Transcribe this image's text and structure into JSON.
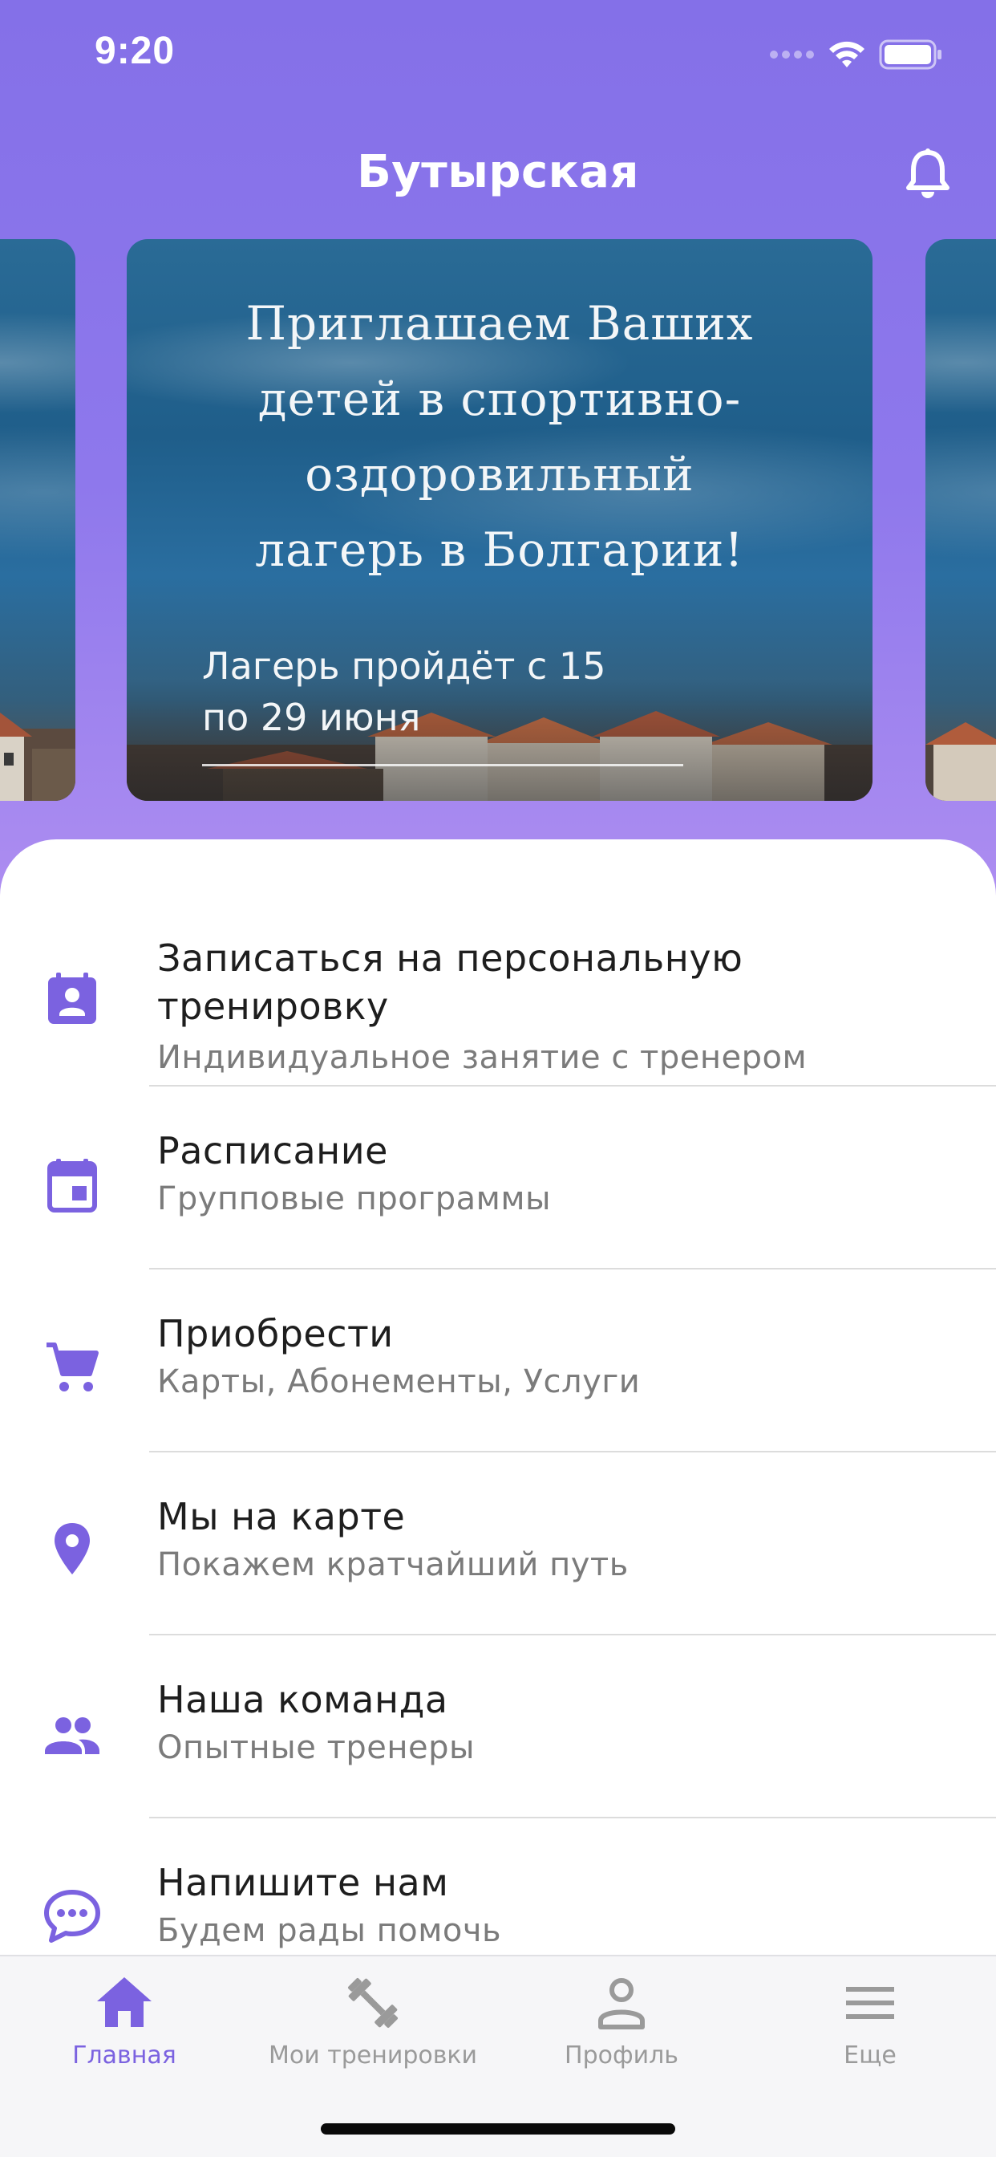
{
  "status_bar": {
    "time": "9:20"
  },
  "header": {
    "title": "Бутырская"
  },
  "banner": {
    "headline": "Приглашаем Ваших\nдетей в спортивно-\nоздоровильный\nлагерь в Болгарии!",
    "subtitle": "Лагерь пройдёт с 15\nпо 29 июня"
  },
  "menu": [
    {
      "icon": "contact-calendar-icon",
      "title": "Записаться на персональную тренировку",
      "subtitle": "Индивидуальное занятие с тренером"
    },
    {
      "icon": "calendar-icon",
      "title": "Расписание",
      "subtitle": "Групповые программы"
    },
    {
      "icon": "cart-icon",
      "title": "Приобрести",
      "subtitle": "Карты, Абонементы, Услуги"
    },
    {
      "icon": "location-pin-icon",
      "title": "Мы на карте",
      "subtitle": "Покажем кратчайший путь"
    },
    {
      "icon": "people-icon",
      "title": "Наша команда",
      "subtitle": "Опытные тренеры"
    },
    {
      "icon": "chat-icon",
      "title": "Напишите нам",
      "subtitle": "Будем рады помочь"
    }
  ],
  "tabs": [
    {
      "icon": "home-icon",
      "label": "Главная",
      "active": true
    },
    {
      "icon": "dumbbell-icon",
      "label": "Мои тренировки",
      "active": false
    },
    {
      "icon": "profile-icon",
      "label": "Профиль",
      "active": false
    },
    {
      "icon": "menu-icon",
      "label": "Еще",
      "active": false
    }
  ],
  "colors": {
    "accent": "#7B62E0",
    "header_gradient_top": "#8470E8",
    "header_gradient_bottom": "#AC8CF1",
    "inactive_tab": "#9A9A9A"
  }
}
